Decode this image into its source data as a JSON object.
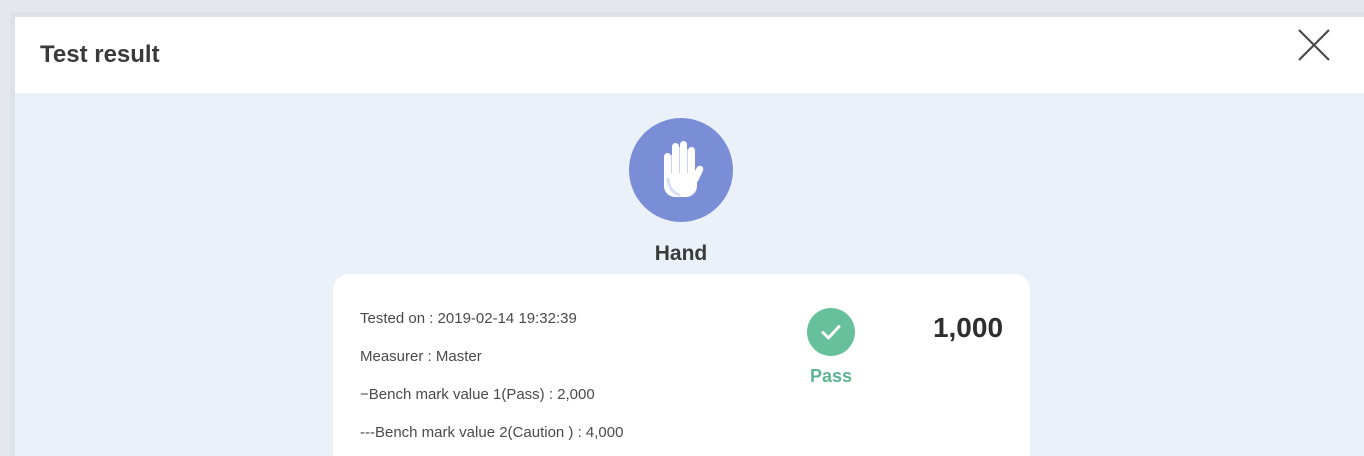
{
  "dialog": {
    "title": "Test result",
    "close_icon": "close-icon"
  },
  "category": {
    "icon": "hand-icon",
    "icon_bg_color": "#7a8ed8",
    "label": "Hand"
  },
  "result": {
    "tested_on": "Tested on : 2019-02-14 19:32:39",
    "measurer": "Measurer : Master",
    "benchmark_1": "−Bench mark value 1(Pass) : 2,000",
    "benchmark_2": "---Bench mark value 2(Caution ) : 4,000",
    "status_icon": "check-circle-icon",
    "status_color": "#66c09b",
    "status_label": "Pass",
    "score": "1,000"
  }
}
